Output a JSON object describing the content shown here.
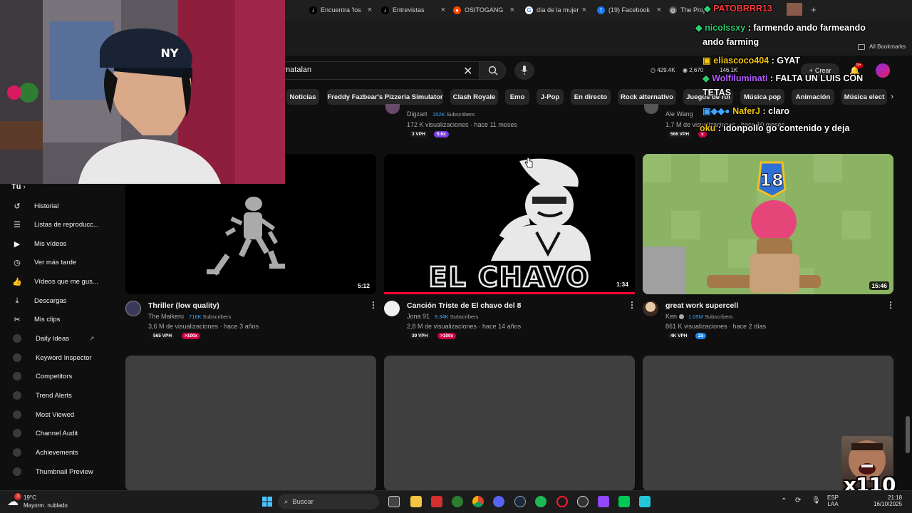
{
  "browser": {
    "tabs": [
      {
        "label": "Encuentra 'los",
        "icon": "tiktok-icon"
      },
      {
        "label": "Entrevistas",
        "icon": "tiktok-icon"
      },
      {
        "label": "OSITOGANG",
        "icon": "reddit-icon"
      },
      {
        "label": "día de la mujer",
        "icon": "google-icon"
      },
      {
        "label": "(19) Facebook",
        "icon": "facebook-icon"
      },
      {
        "label": "The Proje",
        "icon": "globe-icon"
      }
    ],
    "new_tab": "+",
    "bookmarks_label": "All Bookmarks"
  },
  "youtube": {
    "search_value": "matalan",
    "stats": {
      "views": "429.4K",
      "watch": "2,670",
      "subs": "146.1K"
    },
    "create_label": "Crear",
    "notif_count": "9+",
    "chips": [
      "Noticias",
      "Freddy Fazbear's Pizzeria Simulator",
      "Clash Royale",
      "Emo",
      "J-Pop",
      "En directo",
      "Rock alternativo",
      "Juegos de rol",
      "Música pop",
      "Animación",
      "Música elect"
    ],
    "sidebar": {
      "section": "Tú",
      "items": [
        {
          "label": "Historial",
          "icon": "history-icon"
        },
        {
          "label": "Listas de reproducc...",
          "icon": "playlist-icon"
        },
        {
          "label": "Mis vídeos",
          "icon": "video-icon"
        },
        {
          "label": "Ver más tarde",
          "icon": "clock-icon"
        },
        {
          "label": "Vídeos que me gus...",
          "icon": "thumbs-up-icon"
        },
        {
          "label": "Descargas",
          "icon": "download-icon"
        },
        {
          "label": "Mis clips",
          "icon": "scissors-icon"
        }
      ],
      "tools": [
        {
          "label": "Daily Ideas",
          "external": "↗"
        },
        {
          "label": "Keyword Inspector"
        },
        {
          "label": "Competitors"
        },
        {
          "label": "Trend Alerts"
        },
        {
          "label": "Most Viewed"
        },
        {
          "label": "Channel Audit"
        },
        {
          "label": "Achievements"
        },
        {
          "label": "Thumbnail Preview"
        }
      ]
    },
    "top_row": [
      {
        "channel": "Digzart",
        "subs_num": "152K",
        "subs_label": "Subscribers",
        "meta": "172 K visualizaciones · hace 11 meses",
        "vph": "3 VPH",
        "mult": "5.6x"
      },
      {
        "channel": "Ale Wang",
        "meta": "1,7 M de visualizaciones · hace 10 meses",
        "vph": "566 VPH",
        "mult": "x"
      }
    ],
    "videos": [
      {
        "title": "Thriller (low quality)",
        "channel": "The Maikeru",
        "subs_num": "716K",
        "subs_label": "Subscribers",
        "meta": "3,6 M de visualizaciones · hace 3 años",
        "vph": "565 VPH",
        "mult": ">100x",
        "duration": "5:12"
      },
      {
        "title": "Canción Triste de El chavo del 8",
        "channel": "Jona 91",
        "subs_num": "9.34K",
        "subs_label": "Subscribers",
        "meta": "2,8 M de visualizaciones · hace 14 años",
        "vph": "39 VPH",
        "mult": ">100x",
        "duration": "1:34",
        "thumb_text": "EL CHAVO"
      },
      {
        "title": "great work supercell",
        "channel": "Ken",
        "subs_num": "1.05M",
        "subs_label": "Subscribers",
        "meta": "861 K visualizaciones · hace 2 días",
        "vph": "4K VPH",
        "mult": "2x",
        "duration": "15:46",
        "thumb_badge": "18"
      }
    ]
  },
  "chat": [
    {
      "user": "PATOBRRR13",
      "text": ""
    },
    {
      "user": "nicolssxy",
      "text": ": farmendo ando farmeando"
    },
    {
      "user": "",
      "text": "ando farming"
    },
    {
      "user": "eliascoco404",
      "text": ": GYAT"
    },
    {
      "user": "Wolfiluminati",
      "text": ": FALTA UN LUIS CON"
    },
    {
      "user": "",
      "text": "TETAS"
    },
    {
      "user": "NaferJ",
      "text": ": claro"
    },
    {
      "user": "oku",
      "text": ": idonpollo go contenido y deja"
    }
  ],
  "emote_text": "x110",
  "taskbar": {
    "weather_temp": "19°C",
    "weather_desc": "Mayorm. nublado",
    "weather_badge": "3",
    "search_placeholder": "Buscar",
    "lang": "ESP",
    "lang_sub": "LAA",
    "time": "21:18",
    "date": "16/10/2025"
  }
}
